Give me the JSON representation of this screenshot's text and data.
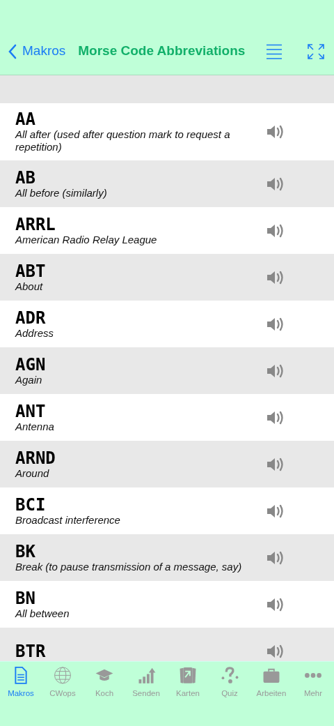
{
  "nav": {
    "back_label": "Makros",
    "title": "Morse Code Abbreviations"
  },
  "rows": [
    {
      "code": "AA",
      "meaning": "All after (used after question mark to request a repetition)"
    },
    {
      "code": "AB",
      "meaning": "All before (similarly)"
    },
    {
      "code": "ARRL",
      "meaning": "American Radio Relay League"
    },
    {
      "code": "ABT",
      "meaning": "About"
    },
    {
      "code": "ADR",
      "meaning": "Address"
    },
    {
      "code": "AGN",
      "meaning": "Again"
    },
    {
      "code": "ANT",
      "meaning": "Antenna"
    },
    {
      "code": "ARND",
      "meaning": "Around"
    },
    {
      "code": "BCI",
      "meaning": "Broadcast interference"
    },
    {
      "code": "BK",
      "meaning": "Break (to pause transmission of a message, say)"
    },
    {
      "code": "BN",
      "meaning": "All between"
    },
    {
      "code": "BTR"
    }
  ],
  "tabs": [
    {
      "label": "Makros",
      "kind": "doc",
      "selected": true
    },
    {
      "label": "CWops",
      "kind": "globe",
      "selected": false
    },
    {
      "label": "Koch",
      "kind": "cap",
      "selected": false
    },
    {
      "label": "Senden",
      "kind": "chart",
      "selected": false
    },
    {
      "label": "Karten",
      "kind": "cards",
      "selected": false
    },
    {
      "label": "Quiz",
      "kind": "quiz",
      "selected": false
    },
    {
      "label": "Arbeiten",
      "kind": "case",
      "selected": false
    },
    {
      "label": "Mehr",
      "kind": "more",
      "selected": false
    }
  ]
}
